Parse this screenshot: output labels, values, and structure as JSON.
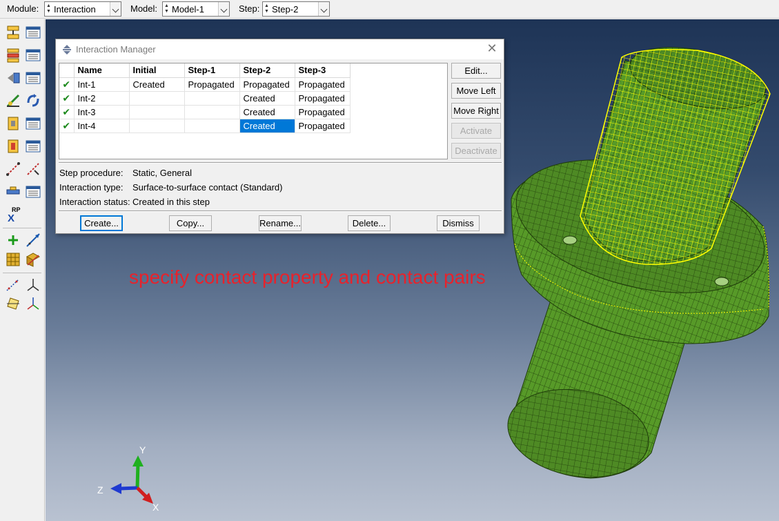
{
  "toolbar": {
    "module_label": "Module:",
    "module_value": "Interaction",
    "model_label": "Model:",
    "model_value": "Model-1",
    "step_label": "Step:",
    "step_value": "Step-2"
  },
  "toolbox": {
    "rp_label": "RP",
    "rp_x": "X",
    "icons": [
      "interaction-create-icon",
      "interaction-manager-icon",
      "interaction-property-create-icon",
      "interaction-property-manager-icon",
      "constraint-create-icon",
      "constraint-manager-icon",
      "connector-section-icon",
      "connector-assign-icon",
      "fastener-create-icon",
      "fastener-manager-icon",
      "special-inertia-icon",
      "special-inertia-manager-icon",
      "wire-create-icon",
      "wire-edit-icon",
      "amplitude-create-icon",
      "amplitude-manager-icon",
      "reference-point-icon",
      "datum-point-icon",
      "datum-axis-icon",
      "partition-face-icon",
      "partition-cell-icon",
      "query-points-icon",
      "query-axis-icon",
      "query-plane-icon",
      "query-csys-icon"
    ]
  },
  "dialog": {
    "title": "Interaction Manager",
    "columns": [
      "Name",
      "Initial",
      "Step-1",
      "Step-2",
      "Step-3"
    ],
    "rows": [
      {
        "check": "✔",
        "name": "Int-1",
        "initial": "Created",
        "step1": "Propagated",
        "step2": "Propagated",
        "step3": "Propagated"
      },
      {
        "check": "✔",
        "name": "Int-2",
        "initial": "",
        "step1": "",
        "step2": "Created",
        "step3": "Propagated"
      },
      {
        "check": "✔",
        "name": "Int-3",
        "initial": "",
        "step1": "",
        "step2": "Created",
        "step3": "Propagated"
      },
      {
        "check": "✔",
        "name": "Int-4",
        "initial": "",
        "step1": "",
        "step2": "Created",
        "step3": "Propagated"
      }
    ],
    "side_buttons": {
      "edit": "Edit...",
      "move_left": "Move Left",
      "move_right": "Move Right",
      "activate": "Activate",
      "deactivate": "Deactivate"
    },
    "info": {
      "step_procedure_label": "Step procedure:",
      "step_procedure_value": "Static, General",
      "interaction_type_label": "Interaction type:",
      "interaction_type_value": "Surface-to-surface contact (Standard)",
      "interaction_status_label": "Interaction status:",
      "interaction_status_value": "Created in this step"
    },
    "bottom_buttons": {
      "create": "Create...",
      "copy": "Copy...",
      "rename": "Rename...",
      "delete": "Delete...",
      "dismiss": "Dismiss"
    }
  },
  "viewport": {
    "annotation": "specify contact property and contact pairs",
    "triad": {
      "y": "Y",
      "z": "Z",
      "x": "X"
    },
    "colors": {
      "mesh": "#4e8a24",
      "highlight": "#ffff00",
      "annotation": "#e8222b"
    }
  }
}
